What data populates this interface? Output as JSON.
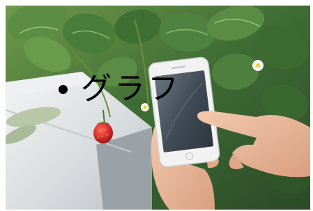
{
  "overlay": {
    "bullet": "•",
    "text": "グラフ"
  },
  "photo": {
    "subjects": [
      "strawberry-plants",
      "hand-holding-smartphone",
      "finger-tapping-screen",
      "red-strawberry",
      "white-strawberry-flowers",
      "hydroponic-planting-trough"
    ],
    "colors": {
      "foliage": "#4f7d3f",
      "foliage_dark": "#2a4a24",
      "trough": "#d9dde0",
      "strawberry": "#d42a2a",
      "phone_body": "#f1f1f1",
      "phone_screen": "#4a5560",
      "skin": "#e8b89b"
    }
  }
}
